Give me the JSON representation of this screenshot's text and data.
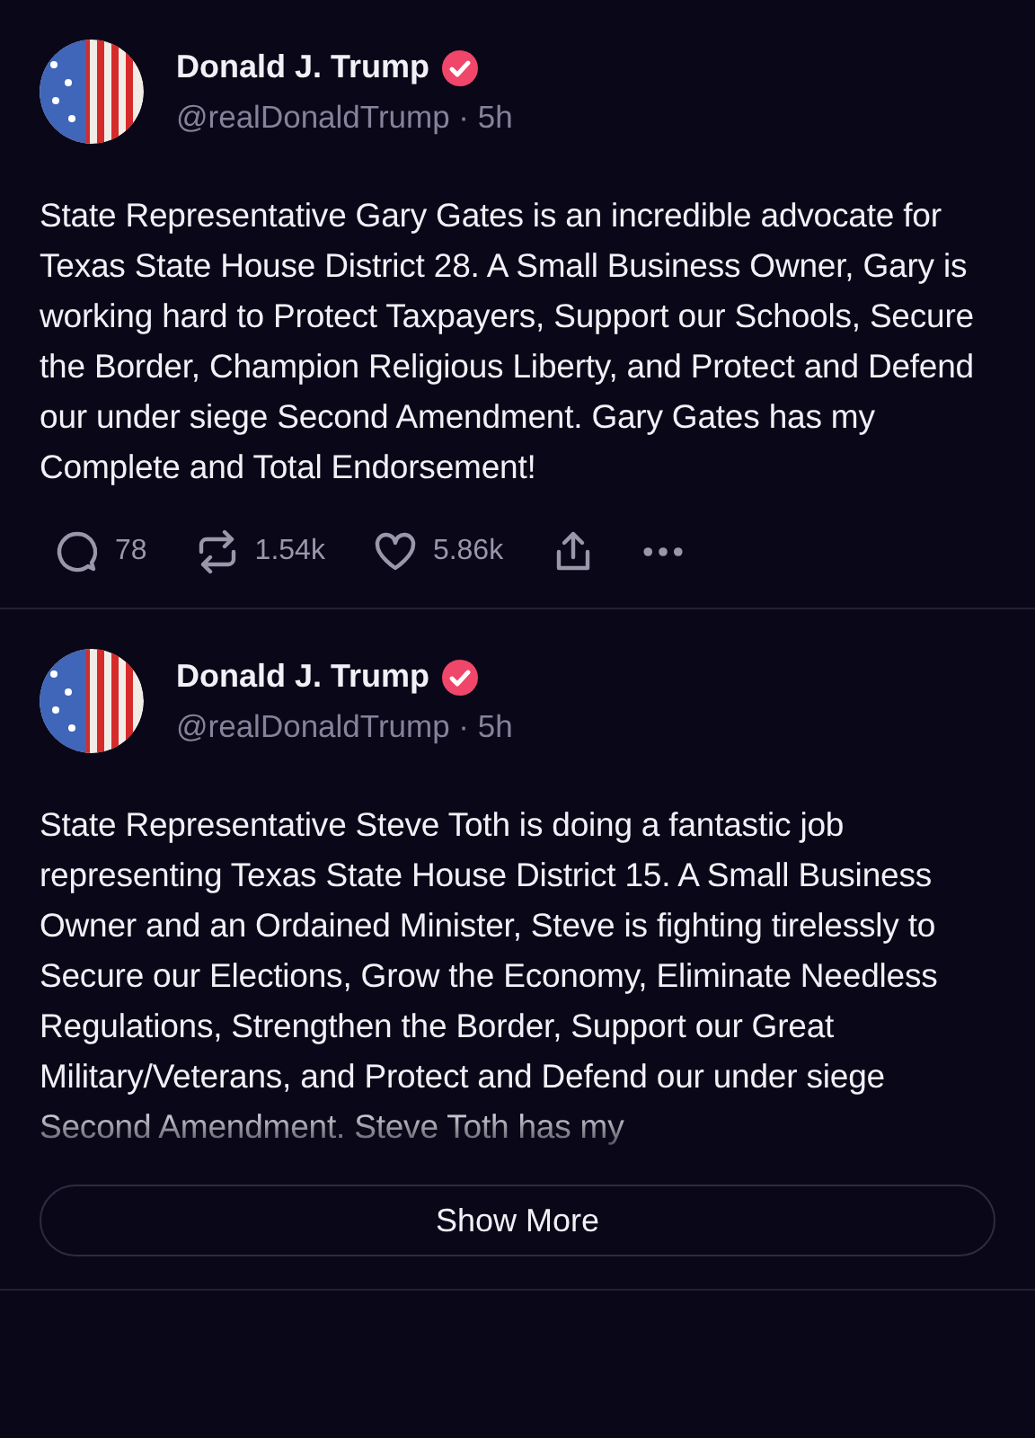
{
  "posts": [
    {
      "author": {
        "name": "Donald J. Trump",
        "verified": true,
        "byline": "@realDonaldTrump · 5h"
      },
      "text": "State Representative Gary Gates is an incredible advocate for Texas State House District 28. A Small Business Owner, Gary is working hard to Protect Taxpayers, Support our Schools, Secure the Border, Champion Religious Liberty, and Protect and Defend our under siege Second Amendment. Gary Gates has my Complete and Total Endorsement!",
      "truncated": false,
      "actions": {
        "replies": "78",
        "reposts": "1.54k",
        "likes": "5.86k"
      }
    },
    {
      "author": {
        "name": "Donald J. Trump",
        "verified": true,
        "byline": "@realDonaldTrump · 5h"
      },
      "text": "State Representative Steve Toth is doing a fantastic job representing Texas State House District 15. A Small Business Owner and an Ordained Minister, Steve is fighting tirelessly to Secure our Elections, Grow the Economy, Eliminate Needless Regulations, Strengthen the Border, Support our Great Military/Veterans, and Protect and Defend our under siege Second Amendment. Steve Toth has my",
      "truncated": true,
      "show_more": "Show More"
    }
  ]
}
